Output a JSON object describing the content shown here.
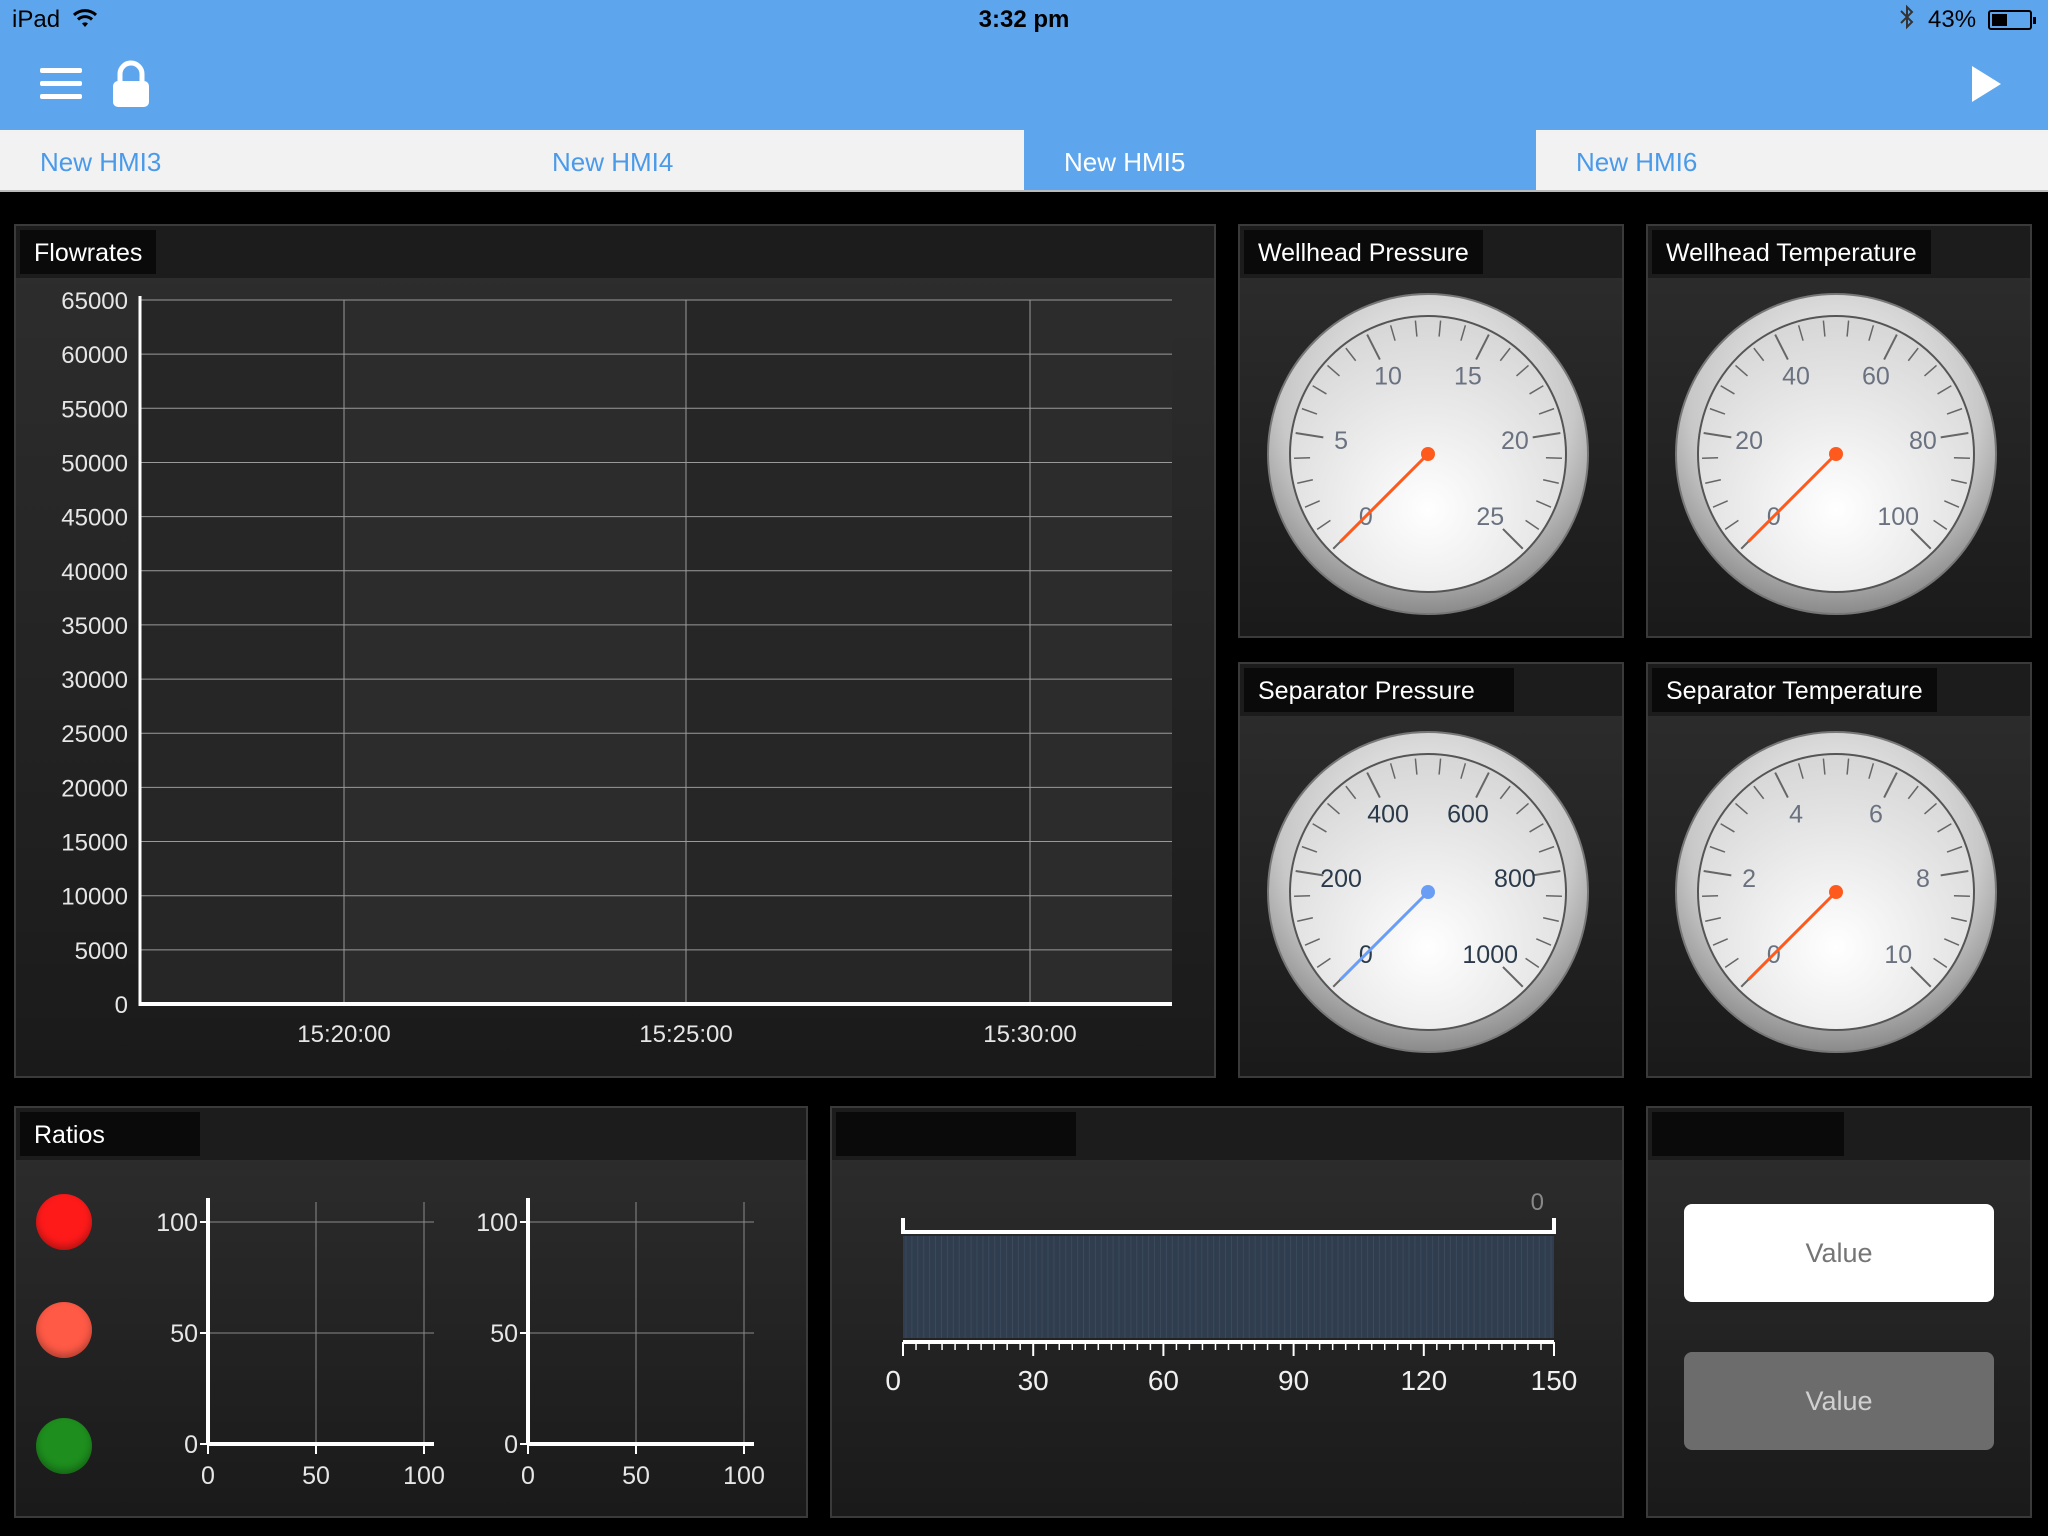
{
  "status_bar": {
    "device": "iPad",
    "time": "3:32 pm",
    "battery_percent": "43%",
    "battery_level": 0.43
  },
  "header": {
    "menu_icon": "hamburger-menu-icon",
    "lock_icon": "lock-icon",
    "play_icon": "play-icon"
  },
  "tabs": [
    {
      "label": "New HMI3",
      "active": false
    },
    {
      "label": "New HMI4",
      "active": false
    },
    {
      "label": "New HMI5",
      "active": true
    },
    {
      "label": "New HMI6",
      "active": false
    }
  ],
  "panels": {
    "flowrates": {
      "title": "Flowrates"
    },
    "wellhead_pressure": {
      "title": "Wellhead Pressure"
    },
    "wellhead_temperature": {
      "title": "Wellhead Temperature"
    },
    "separator_pressure": {
      "title": "Separator Pressure"
    },
    "separator_temperature": {
      "title": "Separator Temperature"
    },
    "ratios": {
      "title": "Ratios"
    },
    "bar": {
      "title": ""
    },
    "values": {
      "title": "",
      "input_placeholder": "Value",
      "display_text": "Value"
    }
  },
  "chart_data": [
    {
      "type": "line",
      "name": "Flowrates",
      "x_ticks": [
        "15:20:00",
        "15:25:00",
        "15:30:00"
      ],
      "y_ticks": [
        0,
        5000,
        10000,
        15000,
        20000,
        25000,
        30000,
        35000,
        40000,
        45000,
        50000,
        55000,
        60000,
        65000
      ],
      "ylim": [
        0,
        65000
      ],
      "grid": true,
      "series": []
    },
    {
      "type": "line",
      "name": "Ratios chart 1",
      "x_ticks": [
        0,
        50,
        100
      ],
      "y_ticks": [
        0,
        50,
        100
      ],
      "xlim": [
        0,
        100
      ],
      "ylim": [
        0,
        100
      ],
      "grid": true,
      "series": []
    },
    {
      "type": "line",
      "name": "Ratios chart 2",
      "x_ticks": [
        0,
        50,
        100
      ],
      "y_ticks": [
        0,
        50,
        100
      ],
      "xlim": [
        0,
        100
      ],
      "ylim": [
        0,
        100
      ],
      "grid": true,
      "series": []
    },
    {
      "type": "bar",
      "name": "Horizontal level bar",
      "value": 0,
      "value_label": "0",
      "x_ticks": [
        0,
        30,
        60,
        90,
        120,
        150
      ],
      "xlim": [
        0,
        150
      ]
    }
  ],
  "gauges": [
    {
      "id": "wp",
      "min": 0,
      "max": 25,
      "labels": [
        0,
        5,
        10,
        15,
        20,
        25
      ],
      "value": 0,
      "needle_color": "#ff5a1e"
    },
    {
      "id": "wt",
      "min": 0,
      "max": 100,
      "labels": [
        0,
        20,
        40,
        60,
        80,
        100
      ],
      "value": 0,
      "needle_color": "#ff5a1e"
    },
    {
      "id": "sp",
      "min": 0,
      "max": 1000,
      "labels": [
        0,
        200,
        400,
        600,
        800,
        1000
      ],
      "value": 0,
      "needle_color": "#6a9ef5"
    },
    {
      "id": "st",
      "min": 0,
      "max": 10,
      "labels": [
        0,
        2,
        4,
        6,
        8,
        10
      ],
      "value": 0,
      "needle_color": "#ff5a1e"
    }
  ],
  "leds": [
    {
      "color": "#ff1a1a"
    },
    {
      "color": "#ff5a46"
    },
    {
      "color": "#1e8f1e"
    }
  ]
}
